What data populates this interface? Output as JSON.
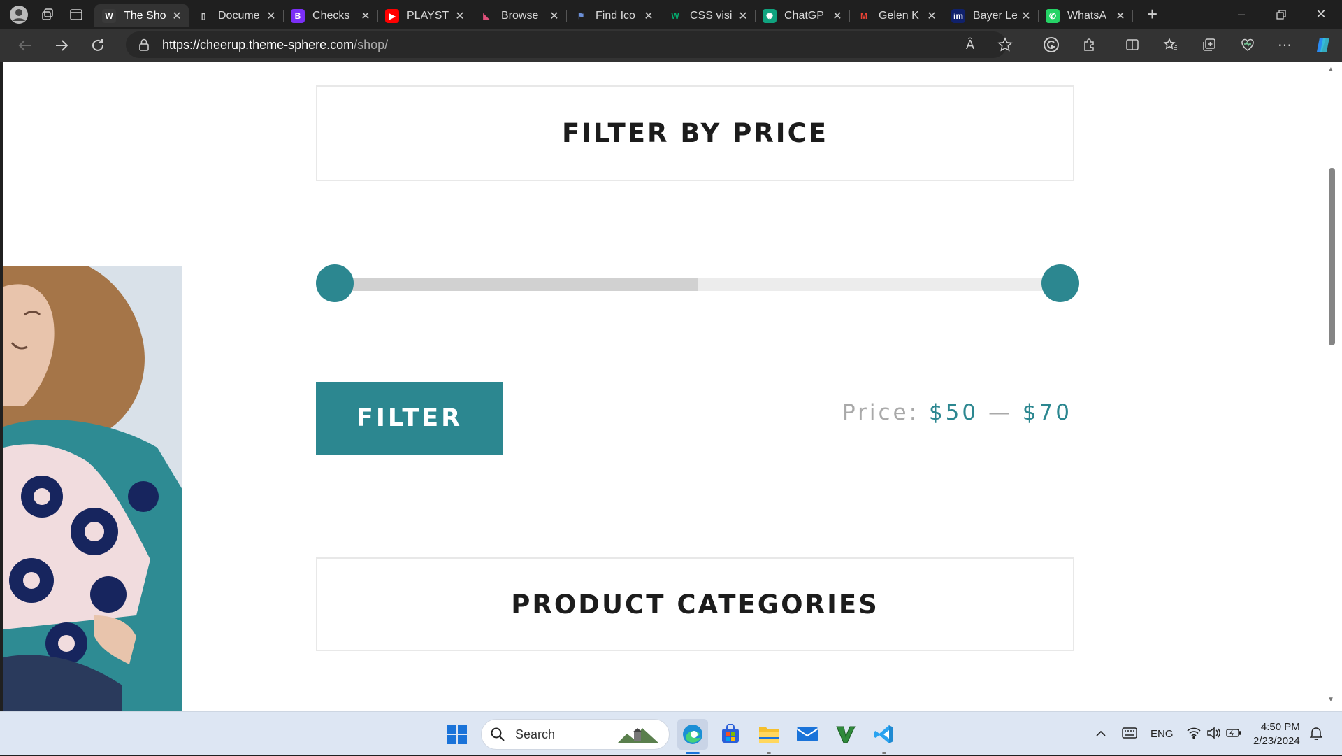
{
  "browser": {
    "tabs": [
      {
        "label": "The Sho",
        "favicon": "wordpress-icon",
        "active": true
      },
      {
        "label": "Docume",
        "favicon": "document-icon"
      },
      {
        "label": "Checks",
        "favicon": "bootstrap-icon"
      },
      {
        "label": "PLAYST",
        "favicon": "youtube-icon"
      },
      {
        "label": "Browse",
        "favicon": "browse-icon"
      },
      {
        "label": "Find Ico",
        "favicon": "flag-icon"
      },
      {
        "label": "CSS visi",
        "favicon": "w3schools-icon"
      },
      {
        "label": "ChatGP",
        "favicon": "chatgpt-icon"
      },
      {
        "label": "Gelen K",
        "favicon": "gmail-icon"
      },
      {
        "label": "Bayer Le",
        "favicon": "bayer-icon"
      },
      {
        "label": "WhatsA",
        "favicon": "whatsapp-icon"
      }
    ],
    "close_glyph": "✕",
    "new_tab_glyph": "+",
    "url_host": "https://cheerup.theme-sphere.com",
    "url_path": "/shop/",
    "read_aloud_glyph": "Â"
  },
  "page": {
    "filter_heading": "FILTER BY PRICE",
    "price_slider": {
      "min_value": 50,
      "max_value": 70,
      "low_fraction": 0.0,
      "high_fraction": 1.0
    },
    "filter_button": "FILTER",
    "price_label": "Price:",
    "price_min": "$50",
    "price_dash": "—",
    "price_max": "$70",
    "categories_heading": "PRODUCT CATEGORIES"
  },
  "taskbar": {
    "search_placeholder": "Search",
    "language": "ENG",
    "time": "4:50 PM",
    "date": "2/23/2024"
  },
  "colors": {
    "accent": "#2c8790",
    "heading": "#1c1c1c",
    "muted": "#a9a9a9"
  }
}
